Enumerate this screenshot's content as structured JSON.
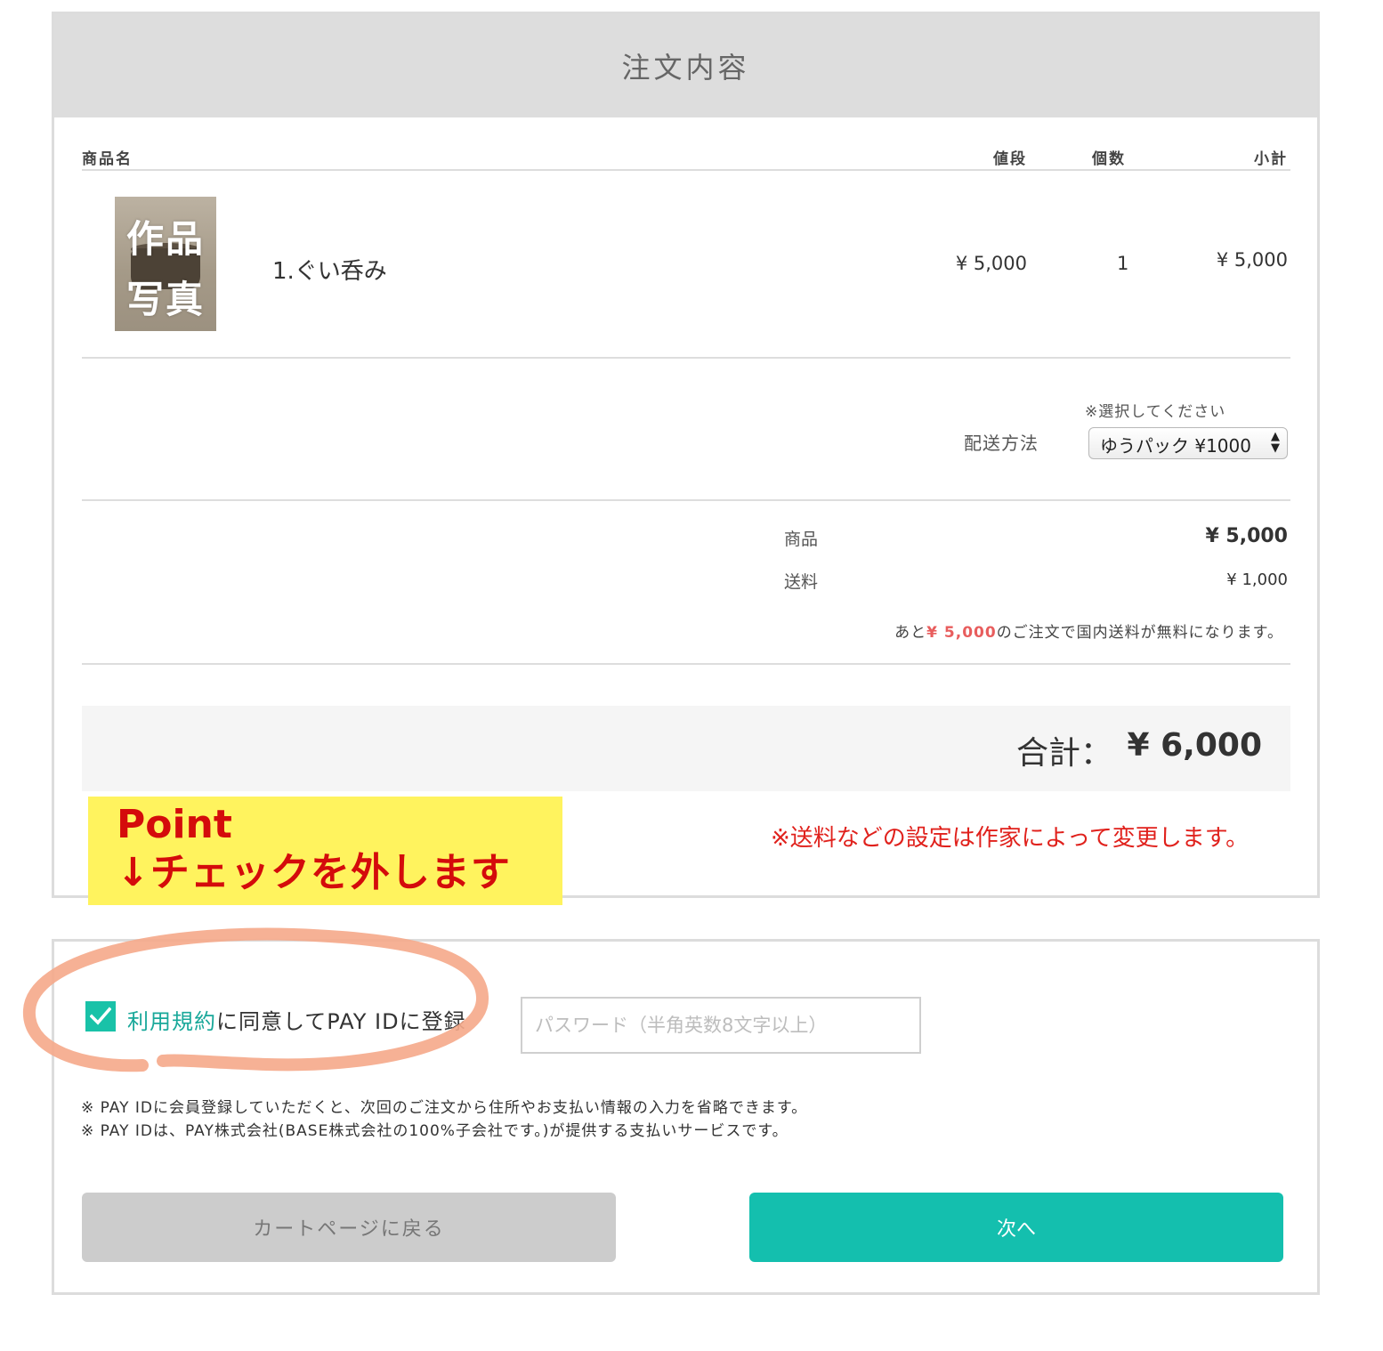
{
  "order": {
    "title": "注文内容",
    "columns": {
      "name": "商品名",
      "price": "値段",
      "qty": "個数",
      "subtotal": "小計"
    },
    "item": {
      "image_caption_top": "作品",
      "image_caption_bottom": "写真",
      "name": "1.ぐい呑み",
      "price": "¥ 5,000",
      "qty": "1",
      "subtotal": "¥ 5,000"
    },
    "shipping": {
      "note": "※選択してください",
      "label": "配送方法",
      "selected": "ゆうパック ¥1000"
    },
    "summary": {
      "goods_label": "商品",
      "goods_value": "¥ 5,000",
      "shipping_label": "送料",
      "shipping_value": "¥ 1,000",
      "free_note_prefix": "あと",
      "free_note_amount": "¥ 5,000",
      "free_note_suffix": "のご注文で国内送料が無料になります。"
    },
    "total": {
      "label": "合計：",
      "value": "¥ 6,000"
    },
    "shipping_change_note": "※送料などの設定は作家によって変更します。"
  },
  "annotation": {
    "title": "Point",
    "text": "↓チェックを外します"
  },
  "register": {
    "checked": true,
    "terms_link": "利用規約",
    "consent_text": "に同意してPAY IDに登録",
    "password_placeholder": "パスワード（半角英数8文字以上）",
    "note1": "※ PAY IDに会員登録していただくと、次回のご注文から住所やお支払い情報の入力を省略できます。",
    "note2": "※ PAY IDは、PAY株式会社(BASE株式会社の100%子会社です。)が提供する支払いサービスです。"
  },
  "buttons": {
    "back": "カートページに戻る",
    "next": "次へ"
  },
  "colors": {
    "accent": "#14bfae",
    "annotation_red": "#d40b0b",
    "annotation_yellow": "#fff35e",
    "circle": "#f5a88a"
  }
}
